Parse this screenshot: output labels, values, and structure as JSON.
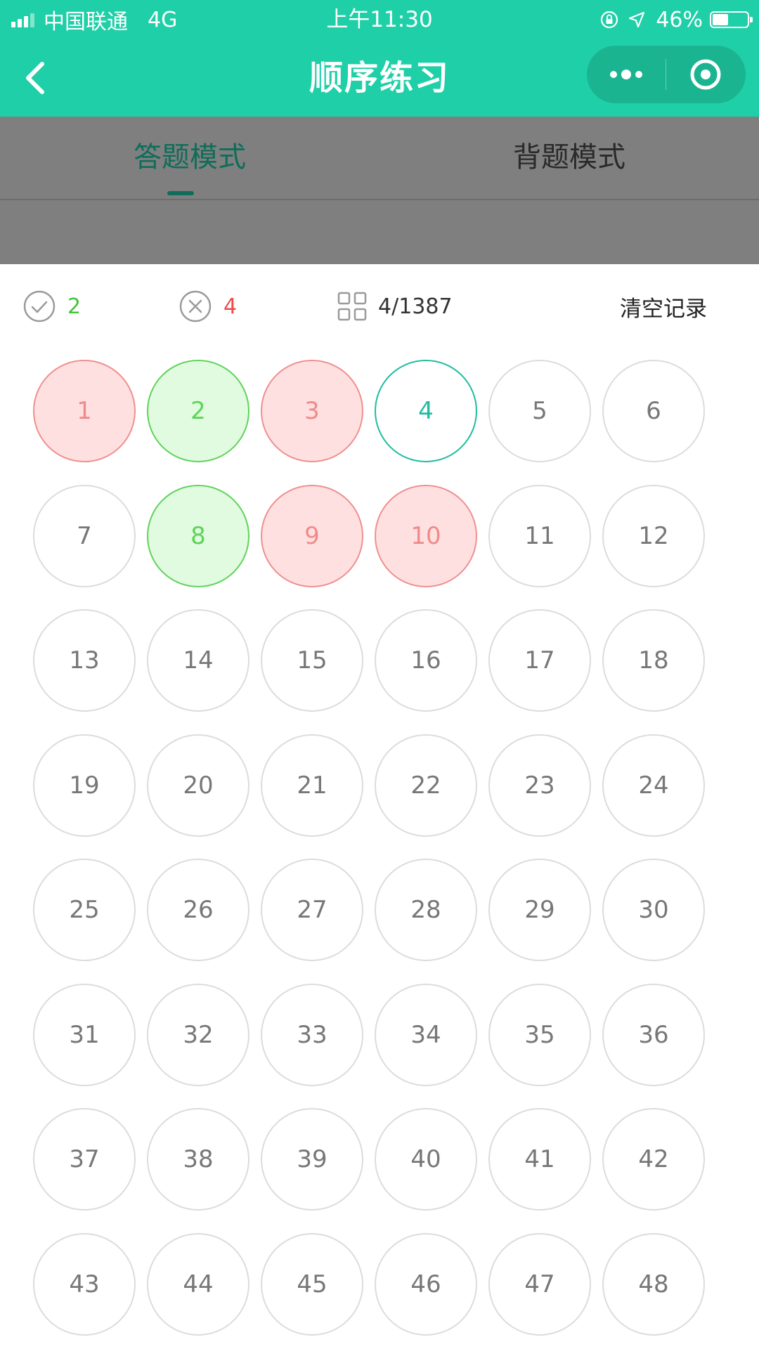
{
  "status_bar": {
    "carrier": "中国联通",
    "network": "4G",
    "time": "上午11:30",
    "battery": "46%",
    "battery_level": 0.46
  },
  "nav": {
    "title": "顺序练习",
    "back_icon": "chevron-left-icon",
    "more_icon": "more-dots-icon",
    "close_icon": "target-close-icon"
  },
  "tabs": [
    {
      "label": "答题模式",
      "active": true
    },
    {
      "label": "背题模式",
      "active": false
    }
  ],
  "stats": {
    "correct_count": "2",
    "wrong_count": "4",
    "progress": "4/1387",
    "clear_label": "清空记录"
  },
  "questions": [
    {
      "n": "1",
      "state": "wrong"
    },
    {
      "n": "2",
      "state": "correct"
    },
    {
      "n": "3",
      "state": "wrong"
    },
    {
      "n": "4",
      "state": "current"
    },
    {
      "n": "5",
      "state": "none"
    },
    {
      "n": "6",
      "state": "none"
    },
    {
      "n": "7",
      "state": "none"
    },
    {
      "n": "8",
      "state": "correct"
    },
    {
      "n": "9",
      "state": "wrong"
    },
    {
      "n": "10",
      "state": "wrong"
    },
    {
      "n": "11",
      "state": "none"
    },
    {
      "n": "12",
      "state": "none"
    },
    {
      "n": "13",
      "state": "none"
    },
    {
      "n": "14",
      "state": "none"
    },
    {
      "n": "15",
      "state": "none"
    },
    {
      "n": "16",
      "state": "none"
    },
    {
      "n": "17",
      "state": "none"
    },
    {
      "n": "18",
      "state": "none"
    },
    {
      "n": "19",
      "state": "none"
    },
    {
      "n": "20",
      "state": "none"
    },
    {
      "n": "21",
      "state": "none"
    },
    {
      "n": "22",
      "state": "none"
    },
    {
      "n": "23",
      "state": "none"
    },
    {
      "n": "24",
      "state": "none"
    },
    {
      "n": "25",
      "state": "none"
    },
    {
      "n": "26",
      "state": "none"
    },
    {
      "n": "27",
      "state": "none"
    },
    {
      "n": "28",
      "state": "none"
    },
    {
      "n": "29",
      "state": "none"
    },
    {
      "n": "30",
      "state": "none"
    },
    {
      "n": "31",
      "state": "none"
    },
    {
      "n": "32",
      "state": "none"
    },
    {
      "n": "33",
      "state": "none"
    },
    {
      "n": "34",
      "state": "none"
    },
    {
      "n": "35",
      "state": "none"
    },
    {
      "n": "36",
      "state": "none"
    },
    {
      "n": "37",
      "state": "none"
    },
    {
      "n": "38",
      "state": "none"
    },
    {
      "n": "39",
      "state": "none"
    },
    {
      "n": "40",
      "state": "none"
    },
    {
      "n": "41",
      "state": "none"
    },
    {
      "n": "42",
      "state": "none"
    },
    {
      "n": "43",
      "state": "none"
    },
    {
      "n": "44",
      "state": "none"
    },
    {
      "n": "45",
      "state": "none"
    },
    {
      "n": "46",
      "state": "none"
    },
    {
      "n": "47",
      "state": "none"
    },
    {
      "n": "48",
      "state": "none"
    }
  ],
  "colors": {
    "brand": "#1fcfa7",
    "correct": "#44c23a",
    "wrong": "#f04a4a",
    "active_tab": "#0f6d5a"
  }
}
